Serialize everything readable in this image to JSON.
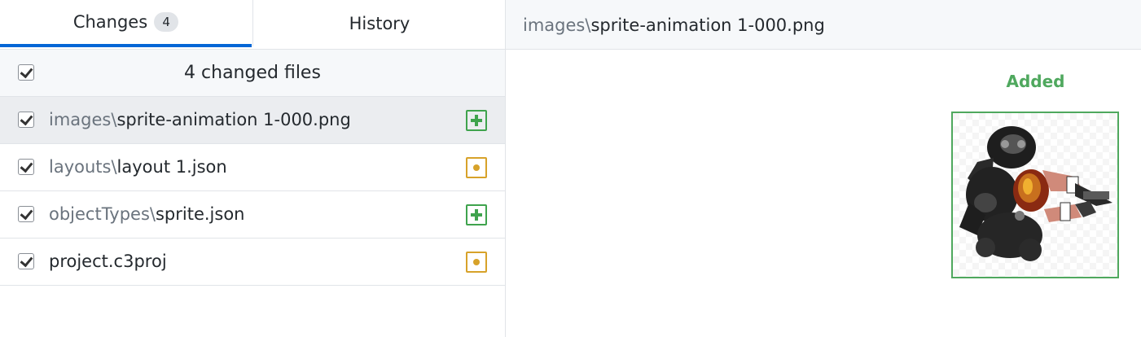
{
  "tabs": {
    "changes_label": "Changes",
    "changes_count": "4",
    "history_label": "History"
  },
  "summary": {
    "label": "4 changed files",
    "checked": true
  },
  "files": [
    {
      "dir": "images\\",
      "name": "sprite-animation 1-000.png",
      "status": "added",
      "selected": true,
      "checked": true
    },
    {
      "dir": "layouts\\",
      "name": "layout 1.json",
      "status": "modified",
      "selected": false,
      "checked": true
    },
    {
      "dir": "objectTypes\\",
      "name": "sprite.json",
      "status": "added",
      "selected": false,
      "checked": true
    },
    {
      "dir": "",
      "name": "project.c3proj",
      "status": "modified",
      "selected": false,
      "checked": true
    }
  ],
  "diff": {
    "path_dir": "images\\",
    "path_name": "sprite-animation 1-000.png",
    "state_label": "Added"
  },
  "colors": {
    "accent": "#0366d6",
    "added": "#3fa34d",
    "modified": "#d7a22a"
  },
  "icons": {
    "added_status": "plus-square-icon",
    "modified_status": "dot-square-icon",
    "checkbox": "checkbox-checked-icon"
  }
}
